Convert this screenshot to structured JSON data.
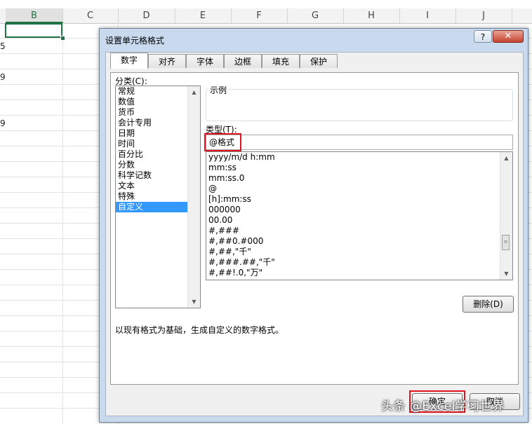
{
  "sheet": {
    "columns": [
      "B",
      "C",
      "D",
      "E",
      "F",
      "G",
      "H",
      "I",
      "J"
    ],
    "active_column": "B",
    "row_fragments": [
      "5",
      "9",
      "9"
    ]
  },
  "dialog": {
    "title": "设置单元格格式",
    "help_label": "?",
    "close_label": "✕",
    "tabs": [
      "数字",
      "对齐",
      "字体",
      "边框",
      "填充",
      "保护"
    ],
    "active_tab": "数字",
    "category_label": "分类(C):",
    "categories": [
      "常规",
      "数值",
      "货币",
      "会计专用",
      "日期",
      "时间",
      "百分比",
      "分数",
      "科学记数",
      "文本",
      "特殊",
      "自定义"
    ],
    "selected_category": "自定义",
    "sample_label": "示例",
    "type_label": "类型(T):",
    "type_value": "@格式",
    "formats": [
      "yyyy/m/d h:mm",
      "mm:ss",
      "mm:ss.0",
      "@",
      "[h]:mm:ss",
      "000000",
      "00.00",
      "#,###",
      "#,##0.#000",
      "#,##,\"千\"",
      "#,###.##,\"千\"",
      "#,##!.0,\"万\""
    ],
    "delete_button": "删除(D)",
    "description": "以现有格式为基础，生成自定义的数字格式。",
    "ok_button": "确定",
    "cancel_button": "取消"
  },
  "watermark": "头条 @Excel学习世界",
  "colors": {
    "accent_green": "#217346",
    "highlight_red": "#e0141e",
    "selection_blue": "#3399ff"
  }
}
